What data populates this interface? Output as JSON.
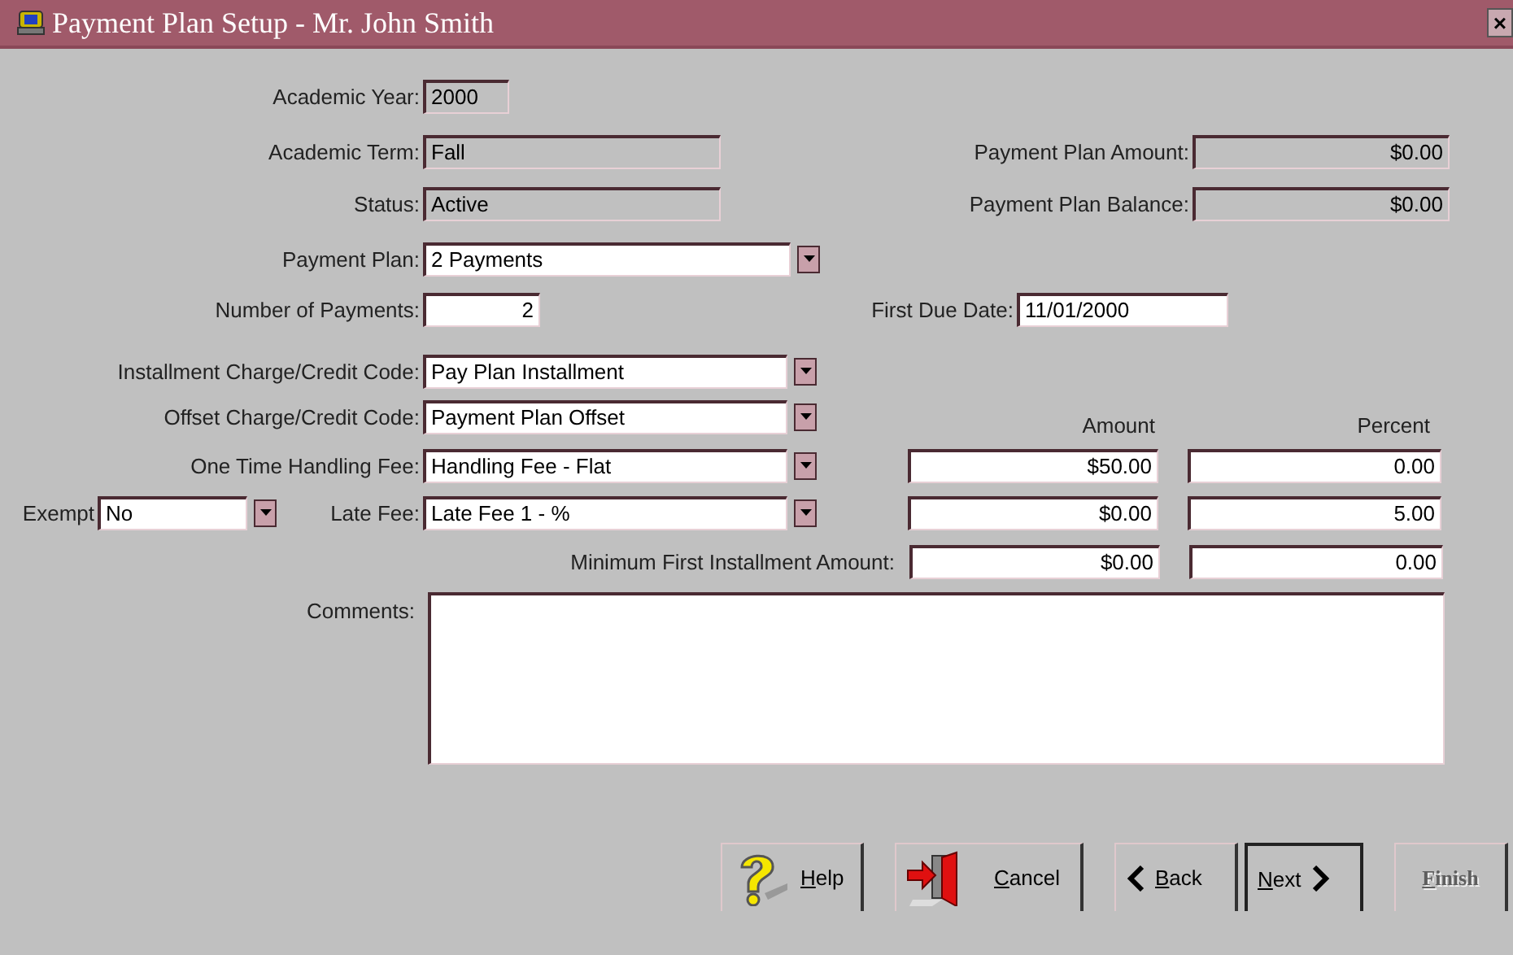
{
  "window": {
    "title": "Payment Plan Setup - Mr. John Smith",
    "close": "×"
  },
  "academic_year": {
    "label": "Academic Year:",
    "value": "2000",
    "readonly": true
  },
  "academic_term": {
    "label": "Academic Term:",
    "value": "Fall",
    "readonly": true
  },
  "payment_plan_amount": {
    "label": "Payment Plan Amount:",
    "value": "$0.00",
    "readonly": true
  },
  "status": {
    "label": "Status:",
    "value": "Active",
    "readonly": true
  },
  "payment_plan_balance": {
    "label": "Payment Plan Balance:",
    "value": "$0.00",
    "readonly": true
  },
  "payment_plan": {
    "label": "Payment Plan:",
    "value": "2 Payments"
  },
  "number_of_payments": {
    "label": "Number of Payments:",
    "value": "2",
    "readonly": false
  },
  "first_due_date": {
    "label": "First Due Date:",
    "value": "11/01/2000",
    "readonly": false
  },
  "installment_code": {
    "label": "Installment Charge/Credit Code:",
    "value": "Pay Plan Installment"
  },
  "offset_code": {
    "label": "Offset Charge/Credit Code:",
    "value": "Payment Plan Offset"
  },
  "fee_columns": {
    "amount": "Amount",
    "percent": "Percent"
  },
  "handling_fee": {
    "label": "One Time Handling Fee:",
    "value": "Handling Fee - Flat",
    "amount": "$50.00",
    "percent": "0.00"
  },
  "exempt": {
    "label": "Exempt",
    "value": "No"
  },
  "late_fee": {
    "label": "Late Fee:",
    "value": "Late Fee 1 - %",
    "amount": "$0.00",
    "percent": "5.00"
  },
  "minimum_first_installment": {
    "label": "Minimum First Installment Amount:",
    "amount": "$0.00",
    "percent": "0.00"
  },
  "comments": {
    "label": "Comments:"
  },
  "buttons": [
    {
      "label": "Help",
      "kind": "help",
      "disabled": false,
      "focused": false
    },
    {
      "label": "Cancel",
      "kind": "cancel",
      "disabled": false,
      "focused": false
    },
    {
      "label": "Back",
      "kind": "back",
      "disabled": false,
      "focused": false
    },
    {
      "label": "Next",
      "kind": "next",
      "disabled": false,
      "focused": true
    },
    {
      "label": "Finish",
      "kind": "finish",
      "disabled": true,
      "focused": false
    }
  ]
}
